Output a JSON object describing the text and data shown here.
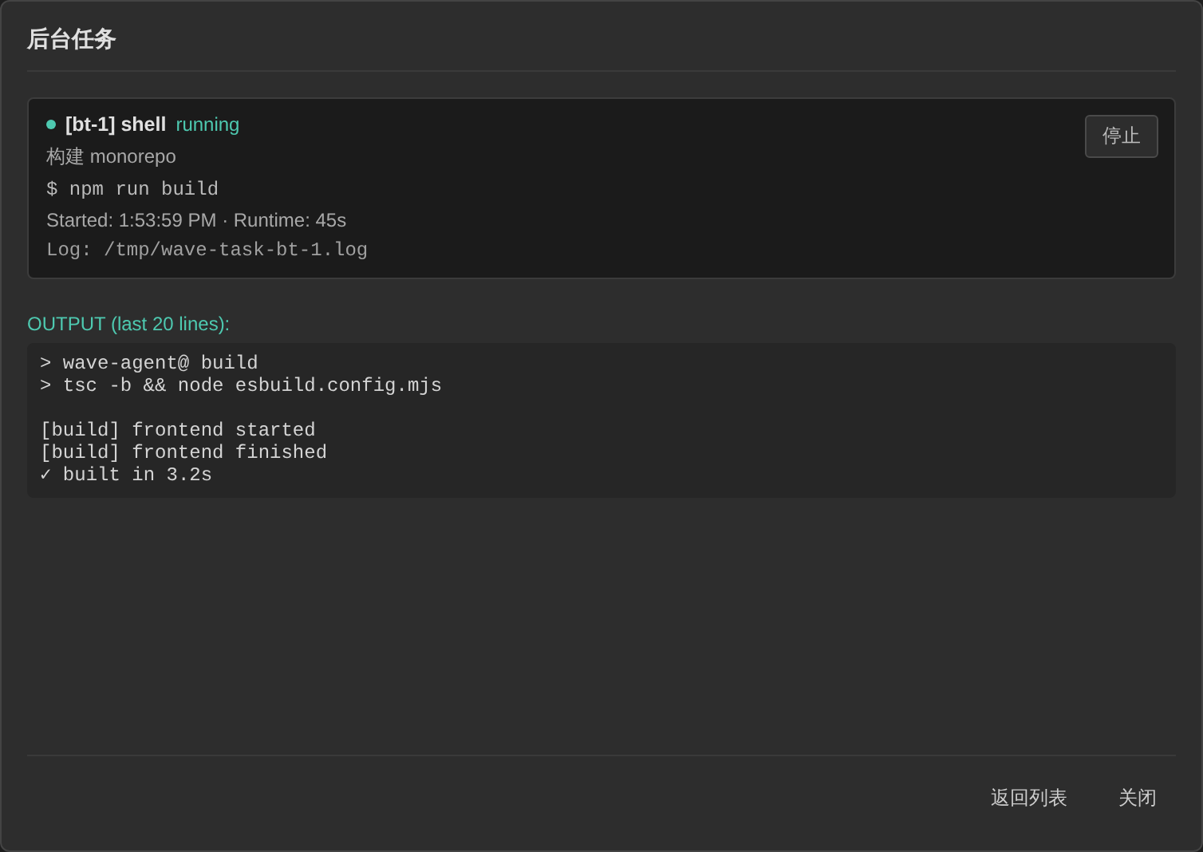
{
  "dialog": {
    "title": "后台任务"
  },
  "task": {
    "id": "[bt-1] shell",
    "status": "running",
    "color": "#4ec9b0",
    "description": "构建 monorepo",
    "command": "$ npm run build",
    "timing": "Started: 1:53:59 PM · Runtime: 45s",
    "log": "Log: /tmp/wave-task-bt-1.log",
    "stop_button": "停止"
  },
  "output": {
    "label": "OUTPUT (last 20 lines):",
    "text": "> wave-agent@ build\n> tsc -b && node esbuild.config.mjs\n\n[build] frontend started\n[build] frontend finished\n✓ built in 3.2s"
  },
  "buttons": [
    "返回列表",
    "关闭"
  ]
}
